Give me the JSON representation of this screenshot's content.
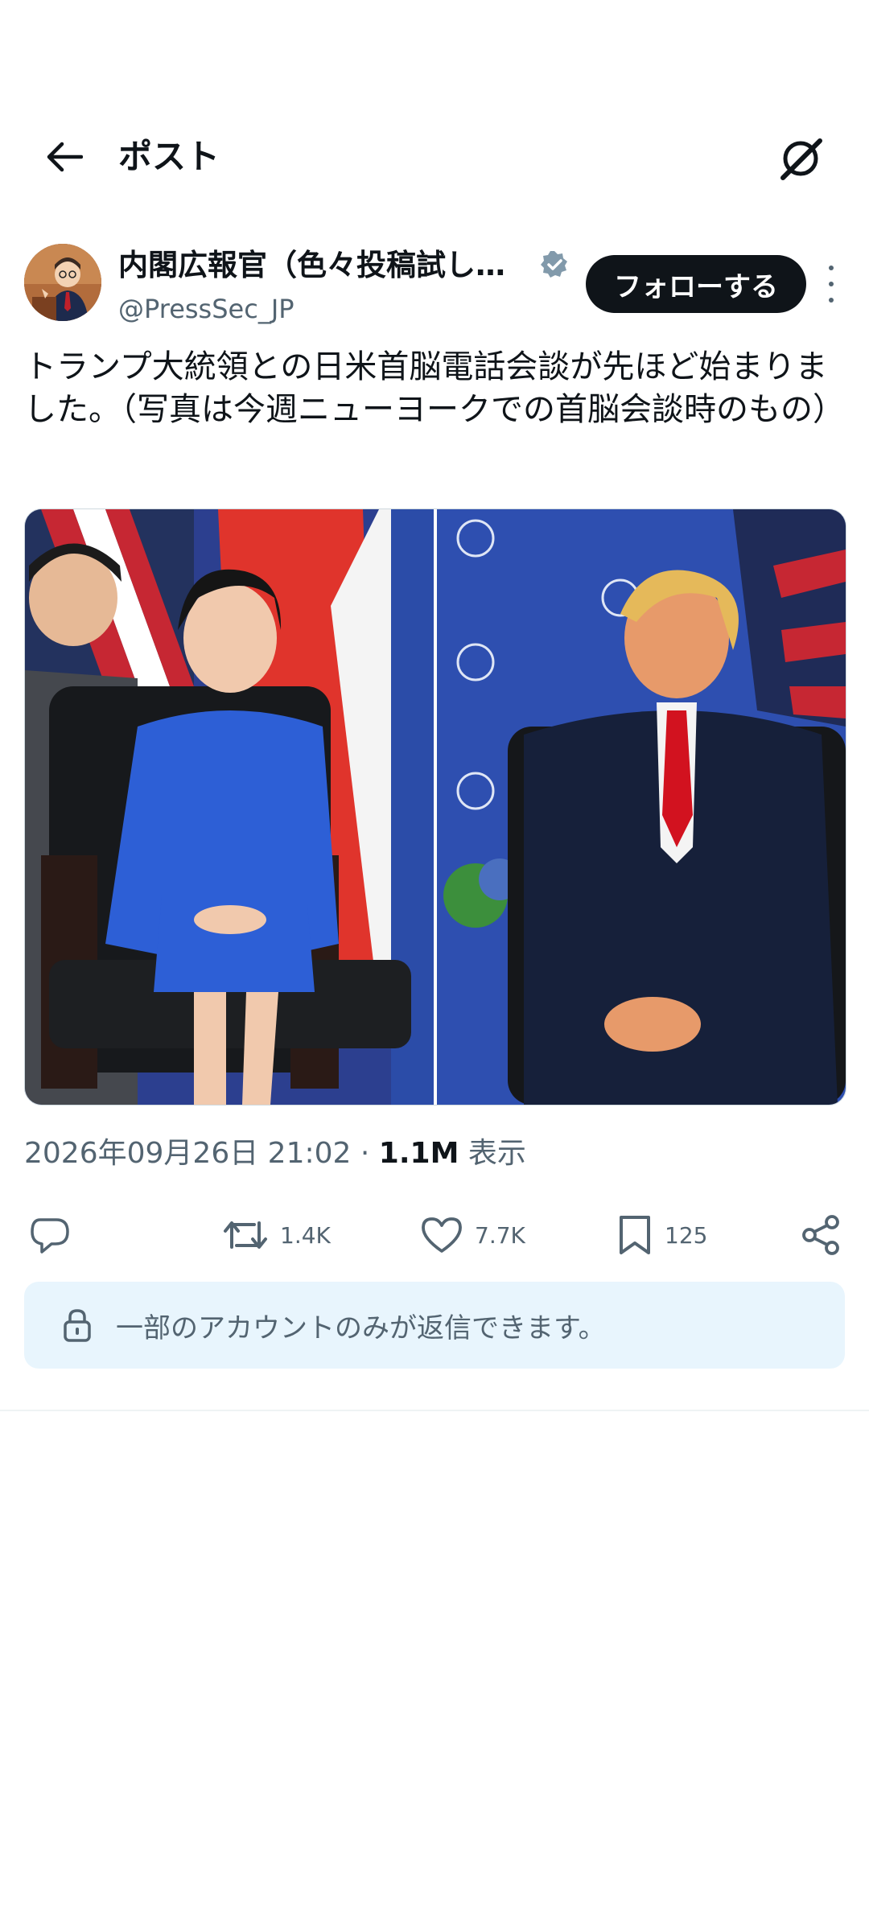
{
  "header": {
    "title": "ポスト",
    "back_icon": "arrow-left-icon",
    "grok_icon": "grok-icon"
  },
  "author": {
    "name": "内閣広報官（色々投稿試し…",
    "handle": "@PressSec_JP",
    "verified": true,
    "follow_label": "フォローする"
  },
  "post": {
    "text": "トランプ大統領との日米首脳電話会談が先ほど始まりました。（写真は今週ニューヨークでの首脳会談時のもの）"
  },
  "meta": {
    "timestamp": "2026年09月26日 21:02",
    "separator": "·",
    "views": "1.1M",
    "views_label": "表示"
  },
  "actions": {
    "reply_icon": "reply-icon",
    "repost_count": "1.4K",
    "like_count": "7.7K",
    "bookmark_count": "125",
    "share_icon": "share-icon"
  },
  "reply_restriction": {
    "text": "一部のアカウントのみが返信できます。"
  },
  "colors": {
    "text": "#0f1419",
    "secondary": "#536471",
    "follow_bg": "#0f1419",
    "restriction_bg": "#e8f5fd",
    "verified": "#829aab"
  }
}
